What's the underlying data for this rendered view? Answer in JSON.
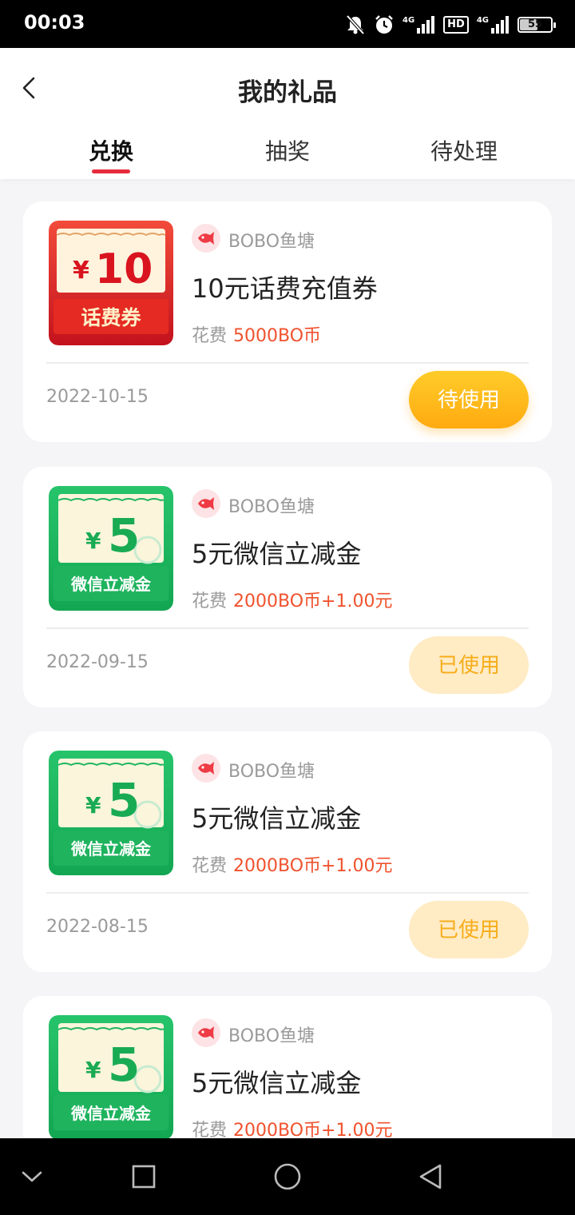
{
  "status": {
    "time": "00:03",
    "signal1_label": "4G",
    "hd_label": "HD",
    "signal2_label": "4G",
    "battery_level": "55"
  },
  "header": {
    "title": "我的礼品",
    "back_icon": "chevron-left-icon"
  },
  "tabs": [
    {
      "label": "兑换",
      "active": true
    },
    {
      "label": "抽奖",
      "active": false
    },
    {
      "label": "待处理",
      "active": false
    }
  ],
  "gifts": [
    {
      "coupon": {
        "currency": "¥",
        "amount": "10",
        "type_label": "话费券",
        "style": "red"
      },
      "shop": "BOBO鱼塘",
      "name": "10元话费充值券",
      "cost_label": "花费",
      "cost": "5000BO币",
      "date": "2022-10-15",
      "status": "待使用",
      "status_kind": "pending"
    },
    {
      "coupon": {
        "currency": "¥",
        "amount": "5",
        "type_label": "微信立减金",
        "style": "green"
      },
      "shop": "BOBO鱼塘",
      "name": "5元微信立减金",
      "cost_label": "花费",
      "cost": "2000BO币+1.00元",
      "date": "2022-09-15",
      "status": "已使用",
      "status_kind": "used"
    },
    {
      "coupon": {
        "currency": "¥",
        "amount": "5",
        "type_label": "微信立减金",
        "style": "green"
      },
      "shop": "BOBO鱼塘",
      "name": "5元微信立减金",
      "cost_label": "花费",
      "cost": "2000BO币+1.00元",
      "date": "2022-08-15",
      "status": "已使用",
      "status_kind": "used"
    },
    {
      "coupon": {
        "currency": "¥",
        "amount": "5",
        "type_label": "微信立减金",
        "style": "green"
      },
      "shop": "BOBO鱼塘",
      "name": "5元微信立减金",
      "cost_label": "花费",
      "cost": "2000BO币+1.00元"
    }
  ],
  "colors": {
    "accent_red": "#e62c3c",
    "price_orange": "#f0522e",
    "pending_yellow": "#ffb818",
    "used_bg": "#ffebc4"
  },
  "navbar": {
    "icons": [
      "chevron-down-icon",
      "square-icon",
      "circle-icon",
      "triangle-back-icon"
    ]
  }
}
